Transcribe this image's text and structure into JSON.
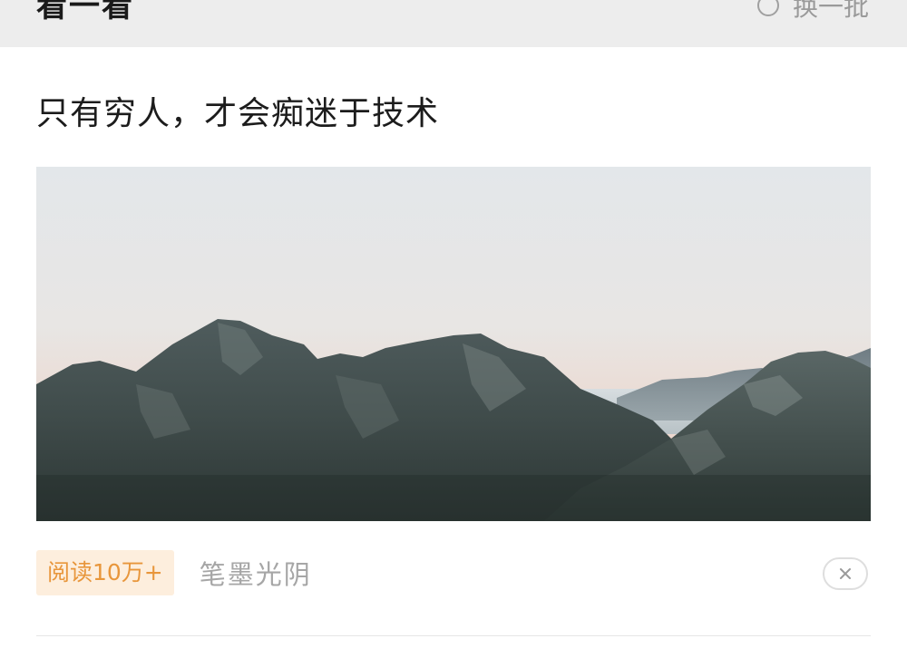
{
  "section": {
    "title": "看一看",
    "refresh_label": "换一批",
    "refresh_icon": "refresh-icon"
  },
  "article": {
    "title": "只有穷人，才会痴迷于技术",
    "cover_icon": "mountain-landscape-image",
    "read_badge": "阅读10万+",
    "source": "笔墨光阴",
    "dismiss_icon": "close-icon"
  },
  "colors": {
    "header_bg": "#ededed",
    "badge_bg": "#fdeedd",
    "badge_text": "#e8963b",
    "muted_text": "#a6a6a6"
  }
}
